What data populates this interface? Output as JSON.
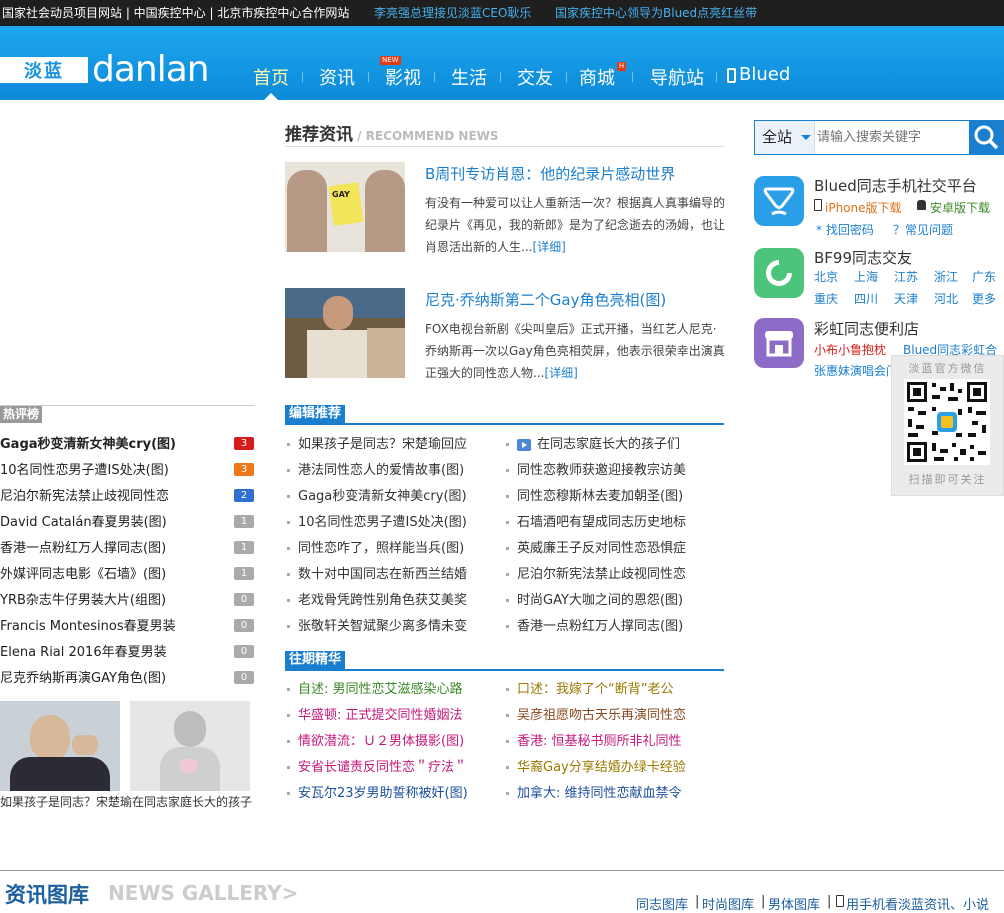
{
  "topbar": {
    "left_text": "国家社会动员项目网站 | 中国疾控中心 | 北京市疾控中心合作网站",
    "news1": "李亮强总理接见淡蓝CEO耿乐",
    "news2": "国家疾控中心领导为Blued点亮红丝带"
  },
  "header": {
    "logo_box": "淡蓝",
    "logo_text": "danlan",
    "nav": [
      "首页",
      "资讯",
      "影视",
      "生活",
      "交友",
      "商城",
      "导航站",
      "Blued"
    ],
    "badge_new": "NEW",
    "badge_h": "H"
  },
  "recommend": {
    "title": "推荐资讯",
    "subtitle": "/ RECOMMEND NEWS",
    "articles": [
      {
        "title": "B周刊专访肖恩：他的纪录片感动世界",
        "body": "有没有一种爱可以让人重新活一次？根据真人真事编导的纪录片《再见，我的新郎》是为了纪念逝去的汤姆，也让肖恩活出新的人生...",
        "more": "[详细]",
        "img_label": "GAY"
      },
      {
        "title": "尼克·乔纳斯第二个Gay角色亮相(图)",
        "body": "FOX电视台新剧《尖叫皇后》正式开播，当红艺人尼克·乔纳斯再一次以Gay角色亮相荧屏，他表示很荣幸出演真正强大的同性恋人物...",
        "more": "[详细]"
      }
    ]
  },
  "editor": {
    "tab": "编辑推荐",
    "left": [
      "如果孩子是同志？宋楚瑜回应",
      "港法同性恋人的爱情故事(图)",
      "Gaga秒变清新女神美cry(图)",
      "10名同性恋男子遭IS处决(图)",
      "同性恋咋了，照样能当兵(图)",
      "数十对中国同志在新西兰结婚",
      "老戏骨凭跨性别角色获艾美奖",
      "张敬轩关智斌聚少离多情未变"
    ],
    "right": [
      "在同志家庭长大的孩子们",
      "同性恋教师获邀迎接教宗访美",
      "同性恋穆斯林去麦加朝圣(图)",
      "石墙酒吧有望成同志历史地标",
      "英威廉王子反对同性恋恐惧症",
      "尼泊尔新宪法禁止歧视同性恋",
      "时尚GAY大咖之间的恩怨(图)",
      "香港一点粉红万人撑同志(图)"
    ]
  },
  "past": {
    "tab": "往期精华",
    "left": [
      {
        "text": "自述: 男同性恋艾滋感染心路",
        "color": "#3b8a25"
      },
      {
        "text": "华盛顿: 正式提交同性婚姻法",
        "color": "#c41a7c"
      },
      {
        "text": "情欲潜流：Ｕ２男体摄影(图)",
        "color": "#c41a7c"
      },
      {
        "text": "安省长谴责反同性恋＂疗法＂",
        "color": "#c41a7c"
      },
      {
        "text": "安瓦尔23岁男助誓称被奸(图)",
        "color": "#1b4f9c"
      }
    ],
    "right": [
      {
        "text": "口述：我嫁了个“断背”老公",
        "color": "#9a7a00"
      },
      {
        "text": "吴彦祖愿吻古天乐再演同性恋",
        "color": "#8a4a20"
      },
      {
        "text": "香港: 恒基秘书厕所非礼同性",
        "color": "#c41a7c"
      },
      {
        "text": "华裔Gay分享结婚办绿卡经验",
        "color": "#9a7a00"
      },
      {
        "text": "加拿大: 维持同性恋献血禁令",
        "color": "#1b4f9c"
      }
    ]
  },
  "hot": {
    "title": "热评榜",
    "items": [
      {
        "text": "Gaga秒变清新女神美cry(图)",
        "rank": "3",
        "color": "#d71c1c",
        "bold": true
      },
      {
        "text": "10名同性恋男子遭IS处决(图)",
        "rank": "3",
        "color": "#f07818",
        "bold": false
      },
      {
        "text": "尼泊尔新宪法禁止歧视同性恋",
        "rank": "2",
        "color": "#2e6fd0",
        "bold": false
      },
      {
        "text": "David Catalán春夏男装(图)",
        "rank": "1",
        "color": "#aaaaaa",
        "bold": false
      },
      {
        "text": "香港一点粉红万人撑同志(图)",
        "rank": "1",
        "color": "#aaaaaa",
        "bold": false
      },
      {
        "text": "外媒评同志电影《石墙》(图)",
        "rank": "1",
        "color": "#aaaaaa",
        "bold": false
      },
      {
        "text": "YRB杂志牛仔男装大片(组图)",
        "rank": "0",
        "color": "#aaaaaa",
        "bold": false
      },
      {
        "text": "Francis Montesinos春夏男装",
        "rank": "0",
        "color": "#aaaaaa",
        "bold": false
      },
      {
        "text": "Elena Rial 2016年春夏男装",
        "rank": "0",
        "color": "#aaaaaa",
        "bold": false
      },
      {
        "text": "尼克乔纳斯再演GAY角色(图)",
        "rank": "0",
        "color": "#aaaaaa",
        "bold": false
      }
    ],
    "caption": "如果孩子是同志？宋楚瑜在同志家庭长大的孩子"
  },
  "search": {
    "scope": "全站",
    "placeholder": "请输入搜索关键字"
  },
  "side": {
    "blued": {
      "title": "Blued同志手机社交平台",
      "iphone": "iPhone版下载",
      "android": "安卓版下载",
      "find": "* 找回密码",
      "faq": "？常见问题"
    },
    "bf99": {
      "title": "BF99同志交友",
      "cities": [
        "北京",
        "上海",
        "江苏",
        "浙江",
        "广东",
        "重庆",
        "四川",
        "天津",
        "河北",
        "更多"
      ]
    },
    "store": {
      "title": "彩虹同志便利店",
      "link1": "小布小鲁抱枕",
      "link2": "Blued同志彩虹合",
      "link3": "张惠妹演唱会门"
    },
    "wechat": {
      "title": "淡蓝官方微信",
      "caption": "扫描即可关注"
    }
  },
  "gallery": {
    "title": "资讯图库",
    "en": "NEWS GALLERY>",
    "links": [
      "同志图库",
      "时尚图库",
      "男体图库",
      "用手机看淡蓝资讯、小说"
    ]
  },
  "colors": {
    "accent": "#1b7fcf",
    "header": "#1a9ae8",
    "topbar": "#1f1f1f"
  }
}
